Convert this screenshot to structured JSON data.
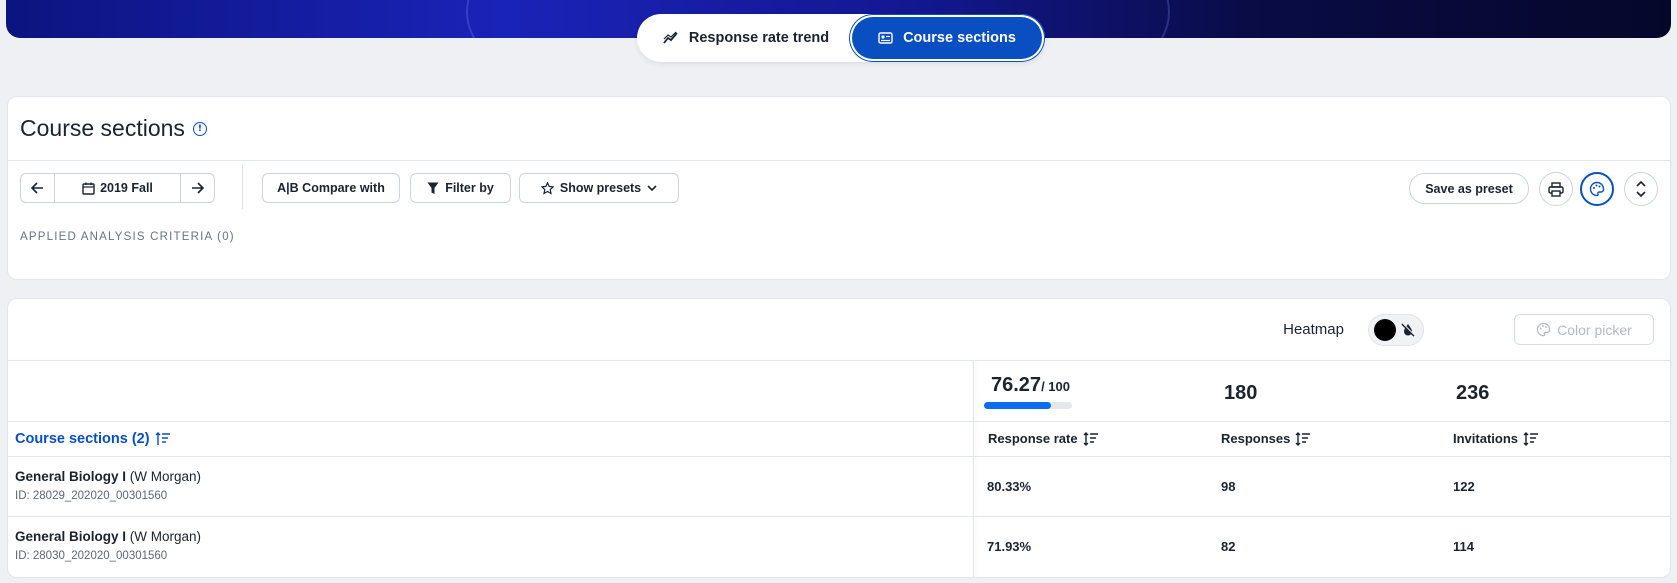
{
  "view_switch": {
    "trend_label": "Response rate trend",
    "sections_label": "Course sections"
  },
  "header": {
    "title": "Course sections"
  },
  "toolbar": {
    "term": "2019 Fall",
    "compare_label": "A|B Compare with",
    "filter_label": "Filter by",
    "presets_label": "Show presets",
    "save_label": "Save as preset"
  },
  "criteria_label": "APPLIED ANALYSIS CRITERIA (0)",
  "heatmap": {
    "label": "Heatmap",
    "color_picker_label": "Color picker"
  },
  "summary": {
    "response_rate": "76.27",
    "response_rate_max": "/ 100",
    "response_rate_fraction": 0.7627,
    "responses": "180",
    "invitations": "236"
  },
  "columns": {
    "course_sections": "Course sections (2)",
    "response_rate": "Response rate",
    "responses": "Responses",
    "invitations": "Invitations"
  },
  "rows": [
    {
      "course": "General Biology I",
      "instructor": "(W Morgan)",
      "id": "ID: 28029_202020_00301560",
      "rate": "80.33%",
      "responses": "98",
      "invitations": "122"
    },
    {
      "course": "General Biology I",
      "instructor": "(W Morgan)",
      "id": "ID: 28030_202020_00301560",
      "rate": "71.93%",
      "responses": "82",
      "invitations": "114"
    }
  ],
  "colors": {
    "accent": "#0a4fc2",
    "bar": "#0a6cf0"
  }
}
